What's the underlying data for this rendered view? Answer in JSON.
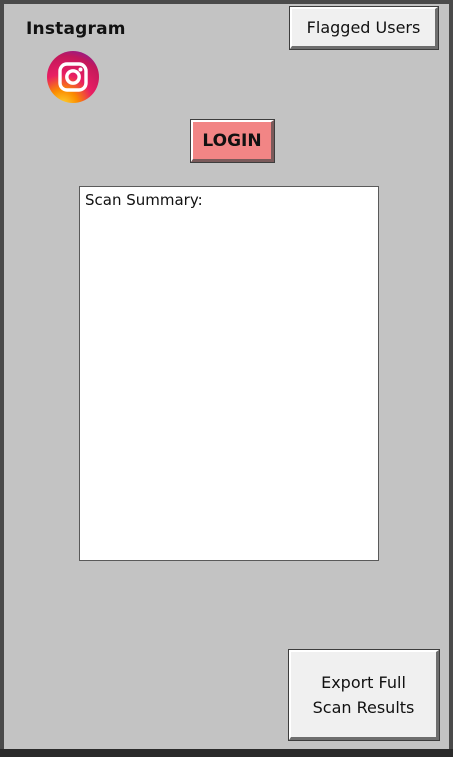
{
  "app": {
    "title": "Instagram",
    "logo_icon": "instagram-logo-icon"
  },
  "toolbar": {
    "flagged_users_label": "Flagged Users",
    "login_label": "LOGIN",
    "export_label": "Export Full\nScan Results"
  },
  "summary": {
    "label": "Scan Summary:"
  },
  "colors": {
    "window_bg": "#c3c3c3",
    "login_bg": "#f28585",
    "button_bg": "#f0f0f0",
    "summary_bg": "#ffffff"
  }
}
